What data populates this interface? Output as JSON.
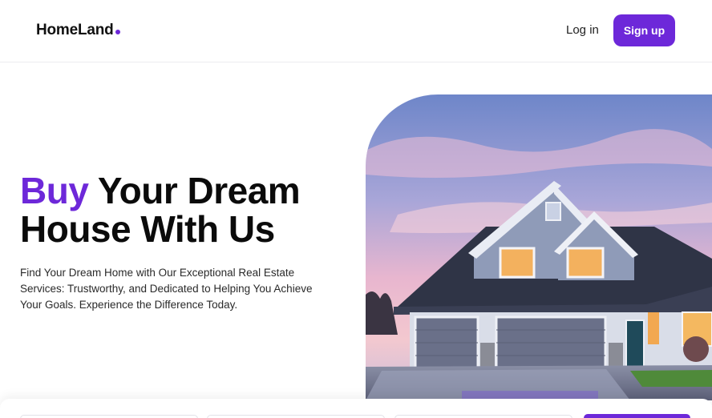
{
  "header": {
    "logo_text": "HomeLand",
    "login_label": "Log in",
    "signup_label": "Sign up"
  },
  "hero": {
    "headline_accent": "Buy",
    "headline_line1_rest": " Your Dream",
    "headline_line2": "House With Us",
    "description": "Find Your Dream Home with Our Exceptional Real Estate Services: Trustworthy, and Dedicated to Helping You Achieve Your Goals. Experience the Difference Today."
  },
  "colors": {
    "accent": "#6d28d9",
    "text": "#0b0b0b"
  }
}
